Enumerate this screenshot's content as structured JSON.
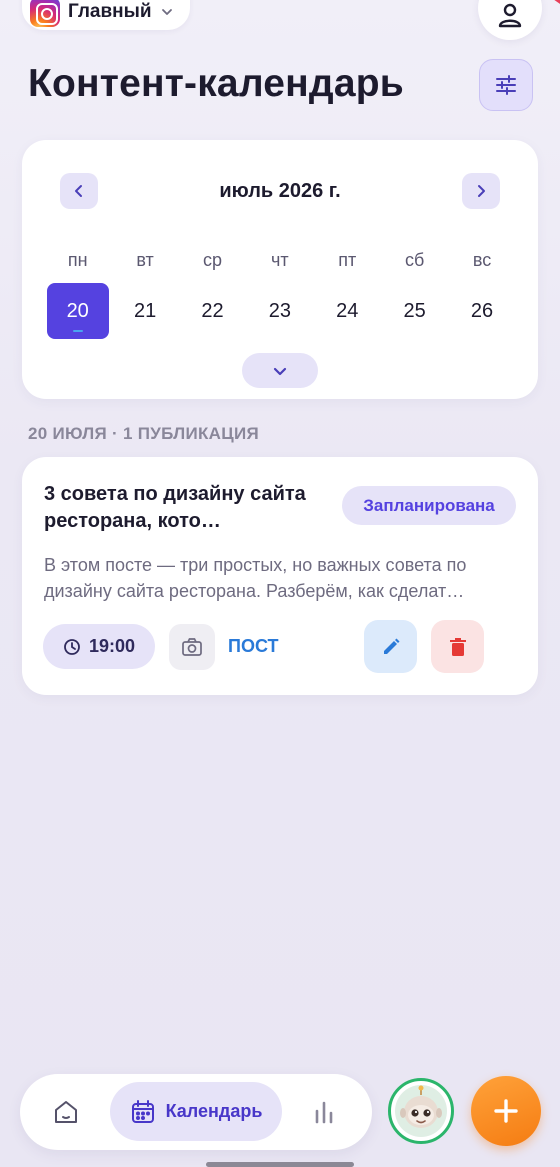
{
  "header": {
    "account_name": "Главный",
    "page_title": "Контент-календарь"
  },
  "calendar": {
    "month_label": "июль 2026 г.",
    "weekdays": [
      "пн",
      "вт",
      "ср",
      "чт",
      "пт",
      "сб",
      "вс"
    ],
    "days": [
      "20",
      "21",
      "22",
      "23",
      "24",
      "25",
      "26"
    ],
    "selected_day": "20"
  },
  "day_section": {
    "header": "20 ИЮЛЯ · 1 ПУБЛИКАЦИЯ"
  },
  "post": {
    "title": "3 совета по дизайну сайта ресторана, кото…",
    "status": "Запланирована",
    "excerpt": "В этом посте — три простых, но важных совета по дизайну сайта ресторана. Разберём, как сделат…",
    "time": "19:00",
    "type": "ПОСТ"
  },
  "bottom_nav": {
    "calendar_label": "Календарь"
  },
  "icons": {
    "brand": "instagram-icon",
    "dropdown": "chevron-down-icon",
    "profile": "user-icon",
    "filter": "sliders-icon",
    "prev": "chevron-left-icon",
    "next": "chevron-right-icon",
    "expand": "chevron-down-icon",
    "clock": "clock-icon",
    "camera": "camera-icon",
    "edit": "pencil-icon",
    "delete": "trash-icon",
    "home": "home-icon",
    "calendar": "calendar-icon",
    "stats": "bar-chart-icon",
    "add": "plus-icon"
  },
  "colors": {
    "accent": "#5542e0",
    "accent_soft": "#e6e3f8",
    "link_blue": "#2a7ad8",
    "danger": "#e53935",
    "fab_orange": "#f57c12",
    "avatar_ring": "#2bb56b"
  }
}
